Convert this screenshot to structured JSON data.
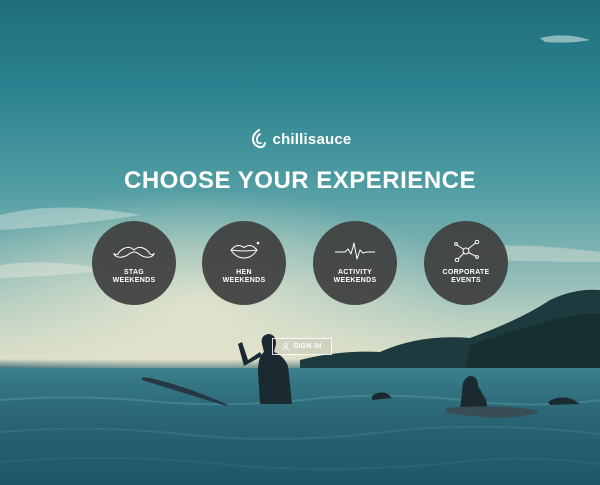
{
  "brand": {
    "name": "chillisauce",
    "logo_icon": "chillisauce-swirl-logo"
  },
  "headline": "CHOOSE YOUR EXPERIENCE",
  "options": [
    {
      "line1": "STAG",
      "line2": "WEEKENDS",
      "icon": "moustache-icon"
    },
    {
      "line1": "HEN",
      "line2": "WEEKENDS",
      "icon": "lips-icon"
    },
    {
      "line1": "ACTIVITY",
      "line2": "WEEKENDS",
      "icon": "pulse-icon"
    },
    {
      "line1": "CORPORATE",
      "line2": "EVENTS",
      "icon": "network-icon"
    }
  ],
  "signin": {
    "label": "SIGN IN",
    "icon": "user-icon"
  },
  "colors": {
    "circle_bg": "#3e3e3e",
    "text": "#ffffff",
    "sea": "#245c6d",
    "sky_top": "#1f6f7a"
  }
}
